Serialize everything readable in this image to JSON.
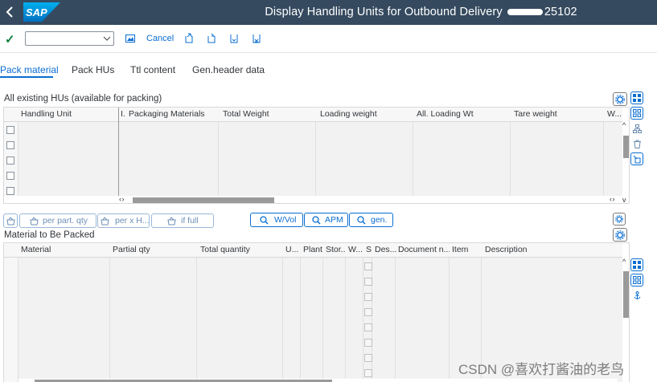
{
  "shell": {
    "logo_text": "SAP",
    "title_prefix": "Display Handling Units for Outbound Delivery",
    "title_suffix": "25102"
  },
  "toolbar": {
    "command_value": "",
    "cancel_label": "Cancel"
  },
  "tabs": [
    {
      "label": "Pack material",
      "active": true
    },
    {
      "label": "Pack HUs",
      "active": false
    },
    {
      "label": "Ttl content",
      "active": false
    },
    {
      "label": "Gen.header data",
      "active": false
    }
  ],
  "hu_section": {
    "title": "All existing HUs (available for packing)",
    "columns": [
      "Handling Unit",
      "I.",
      "Packaging Materials",
      "Total Weight",
      "Loading weight",
      "All. Loading Wt",
      "Tare weight",
      "W..."
    ],
    "row_count": 5
  },
  "action_buttons": [
    {
      "label": "per part. qty",
      "enabled": false
    },
    {
      "label": "per x H...",
      "enabled": false
    },
    {
      "label": "if full",
      "enabled": false
    },
    {
      "label": "W/Vol",
      "enabled": true
    },
    {
      "label": "APM",
      "enabled": true
    },
    {
      "label": "gen.",
      "enabled": true
    }
  ],
  "material_section": {
    "title": "Material to Be Packed",
    "columns": [
      "Material",
      "Partial qty",
      "Total quantity",
      "U...",
      "Plant",
      "Stor...",
      "W...",
      "S",
      "Des...",
      "Document n...",
      "Item",
      "Description"
    ],
    "row_count": 8
  },
  "scroll": {
    "left": "‹ ›",
    "right": "‹ ›"
  },
  "watermark": "CSDN @喜欢打酱油的老鸟",
  "colors": {
    "shell": "#354a5f",
    "accent": "#0a6ed1",
    "confirm": "#107e3e"
  }
}
